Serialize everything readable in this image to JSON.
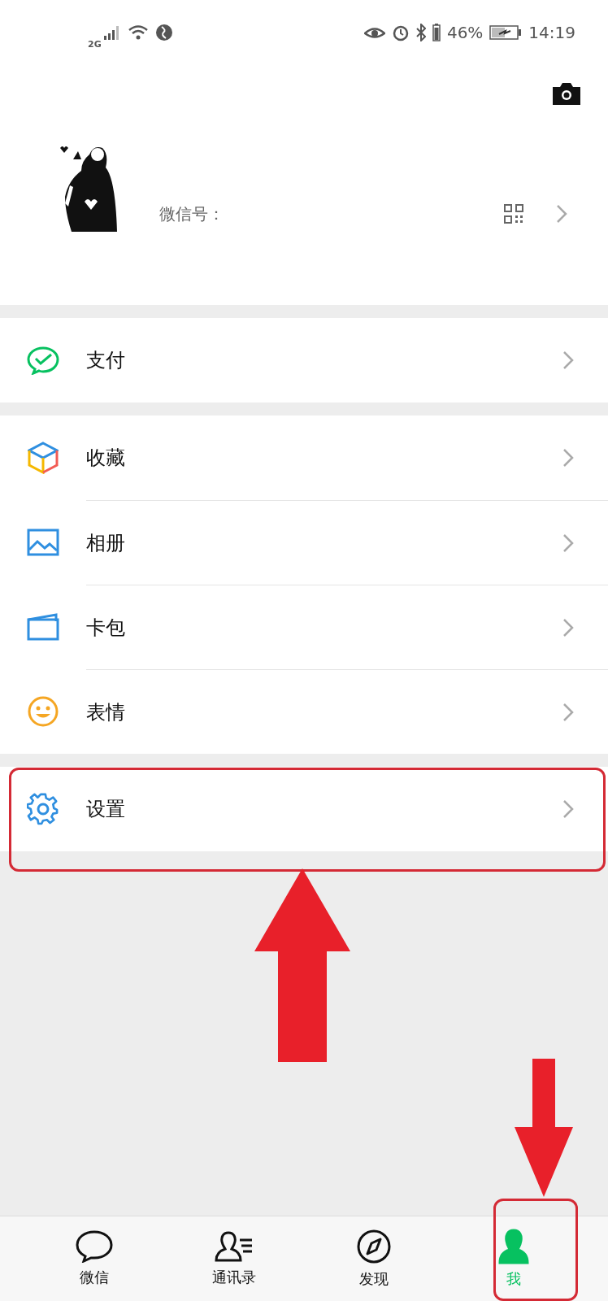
{
  "status_bar": {
    "network": "2G",
    "battery": "46%",
    "time": "14:19"
  },
  "profile": {
    "wechat_id_label": "微信号："
  },
  "menu_groups": [
    [
      {
        "label": "支付",
        "kind": "pay"
      }
    ],
    [
      {
        "label": "收藏",
        "kind": "favorites"
      },
      {
        "label": "相册",
        "kind": "album"
      },
      {
        "label": "卡包",
        "kind": "cards"
      },
      {
        "label": "表情",
        "kind": "stickers"
      }
    ],
    [
      {
        "label": "设置",
        "kind": "settings"
      }
    ]
  ],
  "tab_bar": [
    {
      "label": "微信",
      "kind": "chats",
      "selected": false
    },
    {
      "label": "通讯录",
      "kind": "contacts",
      "selected": false
    },
    {
      "label": "发现",
      "kind": "discover",
      "selected": false
    },
    {
      "label": "我",
      "kind": "me",
      "selected": true
    }
  ]
}
